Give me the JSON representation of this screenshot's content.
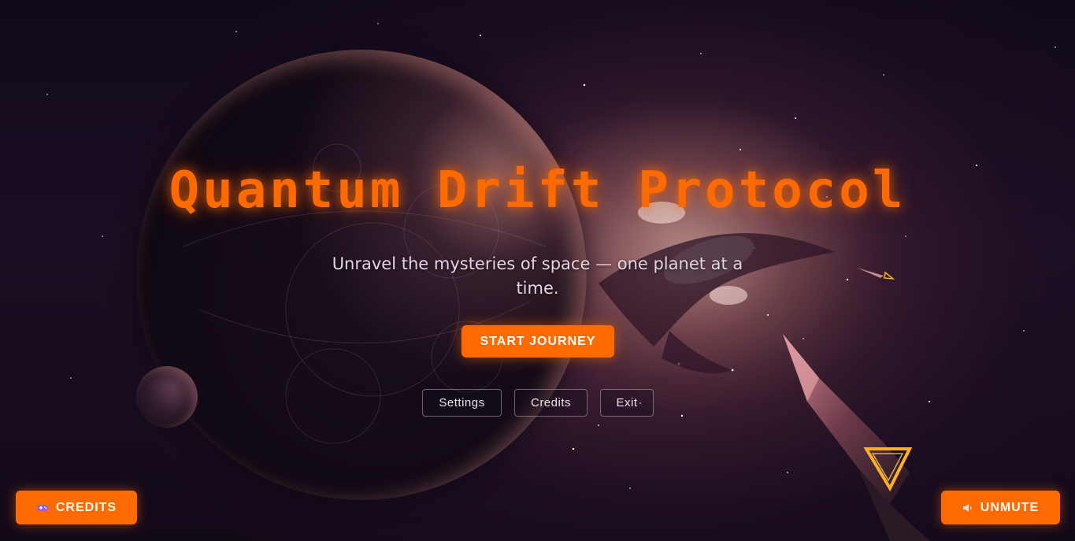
{
  "title": "Quantum Drift Protocol",
  "subtitle": "Unravel the mysteries of space — one planet at a time.",
  "start_button": "START JOURNEY",
  "menu": {
    "settings": "Settings",
    "credits": "Credits",
    "exit": "Exit"
  },
  "corner_buttons": {
    "credits": {
      "label": "CREDITS",
      "icon": "gamepad-icon"
    },
    "unmute": {
      "label": "UNMUTE",
      "icon": "speaker-icon"
    }
  },
  "colors": {
    "accent": "#ff6a00",
    "text_light": "#e4d6e4",
    "background": "#120a1b"
  }
}
